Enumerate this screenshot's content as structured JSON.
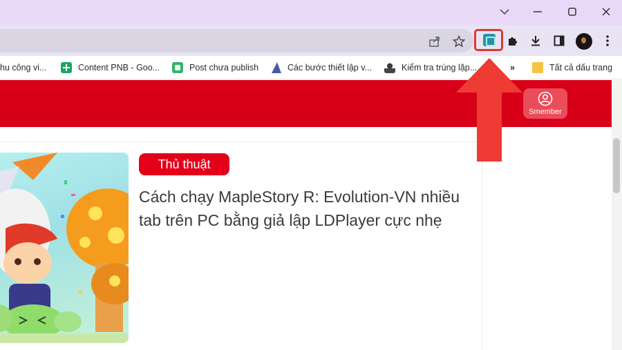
{
  "titlebar": {
    "buttons": [
      "chevron-down",
      "minimize",
      "restore",
      "close"
    ]
  },
  "toolbar": {
    "omnibox_icons": [
      "share-icon",
      "star-icon"
    ],
    "icons": [
      "extension-icon",
      "puzzle-icon",
      "download-icon",
      "sidepanel-icon",
      "avatar",
      "kebab-menu-icon"
    ]
  },
  "bookmarks": {
    "items": [
      {
        "label": "hu công vi...",
        "icon": "none"
      },
      {
        "label": "Content PNB - Goo...",
        "icon": "sheets-icon"
      },
      {
        "label": "Post chưa publish",
        "icon": "green-square-icon"
      },
      {
        "label": "Các bước thiết lập v...",
        "icon": "sail-icon"
      },
      {
        "label": "Kiểm tra trùng lặp...",
        "icon": "detective-icon"
      }
    ],
    "more": "»",
    "all_bookmarks": "Tất cả dấu trang"
  },
  "site": {
    "header_color": "#d70018",
    "smember_label": "Smember"
  },
  "article": {
    "badge": "Thủ thuật",
    "title": "Cách chạy MapleStory R: Evolution-VN nhiều tab trên PC bằng giả lập LDPlayer cực nhẹ"
  },
  "colors": {
    "accent_red": "#e4001b",
    "annotation_arrow": "#ee3b33"
  }
}
